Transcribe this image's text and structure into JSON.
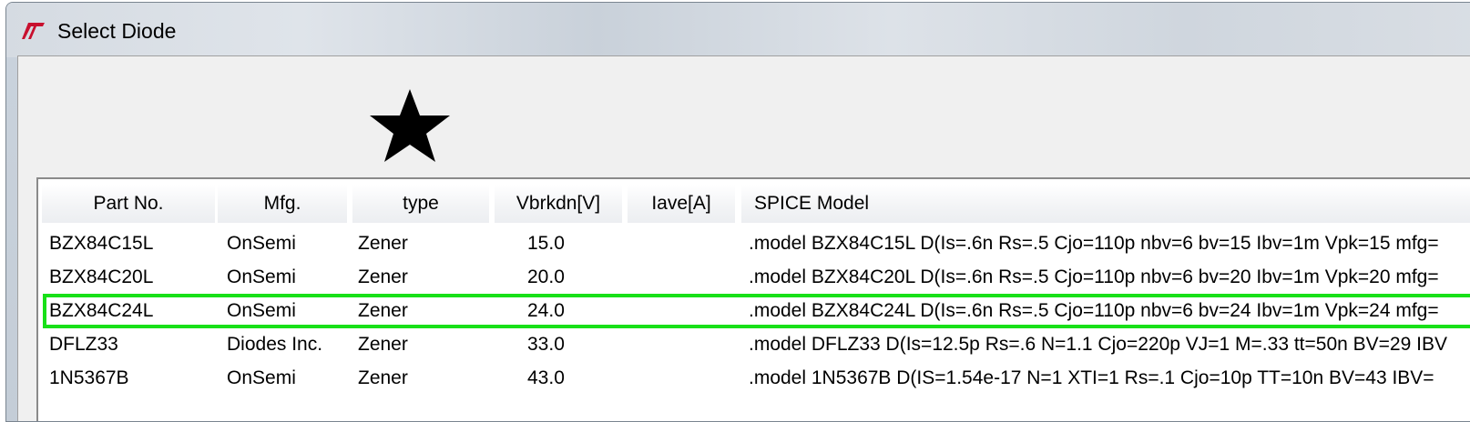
{
  "window": {
    "title": "Select Diode",
    "icon": "ltspice-logo-icon"
  },
  "annotation": {
    "icon": "star-icon",
    "color": "#000000"
  },
  "table": {
    "columns": [
      "Part No.",
      "Mfg.",
      "type",
      "Vbrkdn[V]",
      "Iave[A]",
      "SPICE Model"
    ],
    "rows": [
      {
        "part_no": "BZX84C15L",
        "mfg": "OnSemi",
        "type": "Zener",
        "vbrkdn": "15.0",
        "iave": "",
        "spice_model": ".model BZX84C15L D(Is=.6n Rs=.5 Cjo=110p nbv=6 bv=15 Ibv=1m Vpk=15 mfg=",
        "selected": false
      },
      {
        "part_no": "BZX84C20L",
        "mfg": "OnSemi",
        "type": "Zener",
        "vbrkdn": "20.0",
        "iave": "",
        "spice_model": ".model BZX84C20L D(Is=.6n Rs=.5 Cjo=110p nbv=6 bv=20 Ibv=1m Vpk=20 mfg=",
        "selected": false
      },
      {
        "part_no": "BZX84C24L",
        "mfg": "OnSemi",
        "type": "Zener",
        "vbrkdn": "24.0",
        "iave": "",
        "spice_model": ".model BZX84C24L D(Is=.6n Rs=.5 Cjo=110p nbv=6 bv=24 Ibv=1m Vpk=24 mfg=",
        "selected": true
      },
      {
        "part_no": "DFLZ33",
        "mfg": "Diodes Inc.",
        "type": "Zener",
        "vbrkdn": "33.0",
        "iave": "",
        "spice_model": ".model DFLZ33 D(Is=12.5p Rs=.6 N=1.1 Cjo=220p VJ=1 M=.33 tt=50n BV=29 IBV",
        "selected": false
      },
      {
        "part_no": "1N5367B",
        "mfg": "OnSemi",
        "type": "Zener",
        "vbrkdn": "43.0",
        "iave": "",
        "spice_model": ".model 1N5367B D(IS=1.54e-17 N=1 XTI=1 Rs=.1 Cjo=10p TT=10n BV=43 IBV=",
        "selected": false
      }
    ]
  },
  "colors": {
    "selection_outline": "#18e018"
  }
}
